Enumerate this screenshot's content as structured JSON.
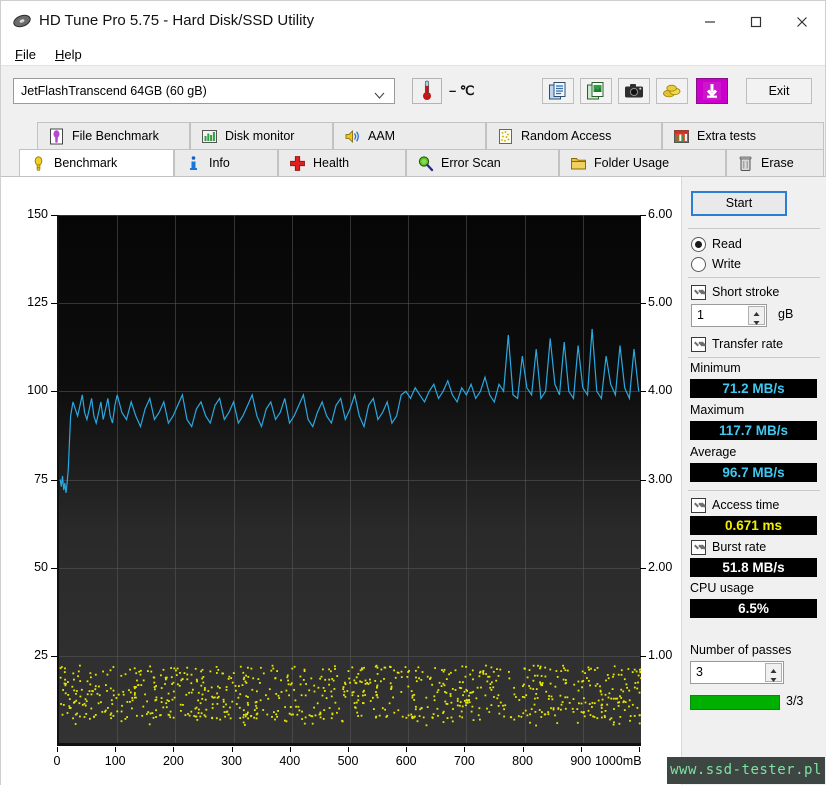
{
  "window": {
    "title": "HD Tune Pro 5.75 - Hard Disk/SSD Utility",
    "app_icon": "hard-disk-icon",
    "minimize": "—",
    "maximize": "□",
    "close": "✕"
  },
  "menu": {
    "items": [
      {
        "label": "File",
        "accel": "F"
      },
      {
        "label": "Help",
        "accel": "H"
      }
    ]
  },
  "toolbar": {
    "drive": "JetFlashTranscend 64GB (60 gB)",
    "temperature": "– ℃",
    "buttons": [
      {
        "name": "copy-text-icon",
        "title": "Copy to clipboard (text)"
      },
      {
        "name": "copy-image-icon",
        "title": "Copy to clipboard (image)"
      },
      {
        "name": "screenshot-icon",
        "title": "Save screenshot"
      },
      {
        "name": "gold-icon",
        "title": "Purchase"
      },
      {
        "name": "download-icon",
        "title": "Download"
      }
    ],
    "exit_label": "Exit"
  },
  "tabs": {
    "row1": [
      {
        "label": "File Benchmark",
        "icon": "file-benchmark-icon",
        "active": false
      },
      {
        "label": "Disk monitor",
        "icon": "disk-monitor-icon",
        "active": false
      },
      {
        "label": "AAM",
        "icon": "speaker-icon",
        "active": false
      },
      {
        "label": "Random Access",
        "icon": "random-access-icon",
        "active": false
      },
      {
        "label": "Extra tests",
        "icon": "extra-tests-icon",
        "active": false
      }
    ],
    "row2": [
      {
        "label": "Benchmark",
        "icon": "lightbulb-icon",
        "active": true
      },
      {
        "label": "Info",
        "icon": "info-icon",
        "active": false
      },
      {
        "label": "Health",
        "icon": "health-cross-icon",
        "active": false
      },
      {
        "label": "Error Scan",
        "icon": "magnifier-icon",
        "active": false
      },
      {
        "label": "Folder Usage",
        "icon": "folder-icon",
        "active": false
      },
      {
        "label": "Erase",
        "icon": "trash-icon",
        "active": false
      }
    ]
  },
  "panel": {
    "start_label": "Start",
    "mode": {
      "read_label": "Read",
      "write_label": "Write",
      "selected": "Read"
    },
    "short_stroke": {
      "label": "Short stroke",
      "checked": true,
      "value": "1",
      "unit": "gB"
    },
    "transfer_rate": {
      "label": "Transfer rate",
      "checked": true
    },
    "minimum": {
      "label": "Minimum",
      "value": "71.2 MB/s"
    },
    "maximum": {
      "label": "Maximum",
      "value": "117.7 MB/s"
    },
    "average": {
      "label": "Average",
      "value": "96.7 MB/s"
    },
    "access_time": {
      "label": "Access time",
      "checked": true,
      "value": "0.671 ms"
    },
    "burst_rate": {
      "label": "Burst rate",
      "checked": true,
      "value": "51.8 MB/s"
    },
    "cpu_usage": {
      "label": "CPU usage",
      "value": "6.5%"
    },
    "passes": {
      "label": "Number of passes",
      "value": "3",
      "progress_text": "3/3",
      "progress_pct": 100
    }
  },
  "watermark": "www.ssd-tester.pl",
  "colors": {
    "transfer_line": "#2aa8e0",
    "access_dots": "#e8e800",
    "plot_bg": "#0d0d0d",
    "accent_blue": "#2a7fd4",
    "value_cyan": "#3fc8f0",
    "value_yellow": "#f2f000",
    "progress_green": "#00b000"
  },
  "chart_data": {
    "type": "line",
    "title": "",
    "xlabel": "mB",
    "ylabel": "MB/s",
    "ylabel_right": "ms",
    "xlim": [
      0,
      1000
    ],
    "ylim": [
      0,
      150
    ],
    "ylim_right": [
      0,
      6.0
    ],
    "xticks": [
      0,
      100,
      200,
      300,
      400,
      500,
      600,
      700,
      800,
      900,
      1000
    ],
    "xticklabels": [
      "0",
      "100",
      "200",
      "300",
      "400",
      "500",
      "600",
      "700",
      "800",
      "900",
      "1000mB"
    ],
    "yticks": [
      25,
      50,
      75,
      100,
      125,
      150
    ],
    "yticklabels": [
      "25",
      "50",
      "75",
      "100",
      "125",
      "150"
    ],
    "yticks_right": [
      1.0,
      2.0,
      3.0,
      4.0,
      5.0,
      6.0
    ],
    "yticklabels_right": [
      "1.00",
      "2.00",
      "3.00",
      "4.00",
      "5.00",
      "6.00"
    ],
    "grid": true,
    "legend": "none",
    "series": [
      {
        "name": "Transfer rate",
        "color": "#2aa8e0",
        "unit": "MB/s",
        "axis": "left",
        "x": [
          2,
          4,
          6,
          8,
          10,
          12,
          14,
          16,
          18,
          20,
          24,
          28,
          32,
          36,
          40,
          44,
          48,
          52,
          56,
          60,
          64,
          68,
          72,
          76,
          80,
          84,
          88,
          92,
          96,
          100,
          108,
          116,
          124,
          132,
          140,
          148,
          156,
          164,
          172,
          180,
          188,
          196,
          204,
          212,
          220,
          228,
          236,
          244,
          252,
          260,
          268,
          276,
          284,
          292,
          300,
          308,
          316,
          324,
          332,
          340,
          348,
          356,
          364,
          372,
          380,
          388,
          396,
          404,
          412,
          420,
          428,
          436,
          444,
          452,
          460,
          468,
          476,
          484,
          492,
          500,
          508,
          516,
          524,
          532,
          540,
          548,
          556,
          564,
          572,
          580,
          588,
          596,
          604,
          612,
          620,
          628,
          636,
          644,
          652,
          660,
          668,
          676,
          684,
          692,
          700,
          708,
          716,
          724,
          732,
          740,
          748,
          756,
          764,
          772,
          780,
          788,
          796,
          804,
          812,
          820,
          828,
          836,
          844,
          852,
          860,
          868,
          876,
          884,
          892,
          900,
          908,
          916,
          924,
          932,
          940,
          948,
          956,
          964,
          972,
          980,
          988,
          996
        ],
        "y": [
          75,
          73,
          76,
          72,
          74,
          71.2,
          74,
          78,
          86,
          93,
          97,
          95,
          93,
          96,
          99,
          94,
          92,
          95,
          98,
          93,
          91,
          94,
          97,
          92,
          95,
          98,
          93,
          91,
          96,
          99,
          94,
          92,
          97,
          93,
          90,
          95,
          98,
          92,
          94,
          97,
          91,
          93,
          96,
          99,
          92,
          90,
          95,
          97,
          93,
          91,
          96,
          98,
          92,
          94,
          97,
          91,
          93,
          96,
          99,
          93,
          90,
          95,
          97,
          92,
          94,
          98,
          91,
          93,
          96,
          99,
          92,
          90,
          94,
          97,
          93,
          91,
          96,
          98,
          92,
          95,
          99,
          93,
          90,
          96,
          98,
          92,
          94,
          97,
          91,
          93,
          99,
          100,
          98,
          101,
          99,
          97,
          100,
          102,
          98,
          100,
          103,
          99,
          97,
          101,
          99,
          102,
          98,
          100,
          104,
          99,
          97,
          102,
          100,
          116,
          99,
          98,
          110,
          101,
          99,
          112,
          98,
          100,
          115,
          102,
          99,
          114,
          100,
          98,
          113,
          101,
          99,
          117.7,
          100,
          98,
          110,
          102,
          99,
          113,
          101,
          98,
          112,
          100
        ]
      },
      {
        "name": "Access time",
        "color": "#e8e800",
        "unit": "ms",
        "axis": "right",
        "mean_ms": 0.671,
        "description": "dense yellow scatter cloud spanning full x range, clustered near the bottom of the plot (approx 0.3-0.9 ms band)",
        "point_count": 900
      }
    ],
    "summary": {
      "minimum_mbs": 71.2,
      "maximum_mbs": 117.7,
      "average_mbs": 96.7,
      "access_time_ms": 0.671,
      "burst_rate_mbs": 51.8,
      "cpu_usage_pct": 6.5
    }
  }
}
